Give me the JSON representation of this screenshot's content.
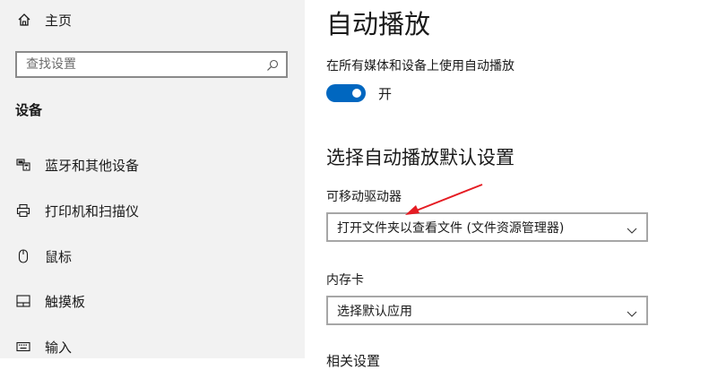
{
  "sidebar": {
    "home_label": "主页",
    "search_placeholder": "查找设置",
    "section_title": "设备",
    "items": [
      {
        "label": "蓝牙和其他设备"
      },
      {
        "label": "打印机和扫描仪"
      },
      {
        "label": "鼠标"
      },
      {
        "label": "触摸板"
      },
      {
        "label": "输入"
      }
    ]
  },
  "main": {
    "title": "自动播放",
    "autoplay_label": "在所有媒体和设备上使用自动播放",
    "toggle_state": "开",
    "defaults_heading": "选择自动播放默认设置",
    "removable_drive": {
      "label": "可移动驱动器",
      "value": "打开文件夹以查看文件 (文件资源管理器)"
    },
    "memory_card": {
      "label": "内存卡",
      "value": "选择默认应用"
    },
    "cut_off_heading": "相关设置"
  },
  "colors": {
    "accent": "#0067c0",
    "annotation_arrow": "#e51c23",
    "sidebar_bg": "#f2f2f2"
  },
  "icons": [
    "home-icon",
    "search-icon",
    "bluetooth-devices-icon",
    "printer-icon",
    "mouse-icon",
    "touchpad-icon",
    "keyboard-icon",
    "chevron-down-icon"
  ]
}
